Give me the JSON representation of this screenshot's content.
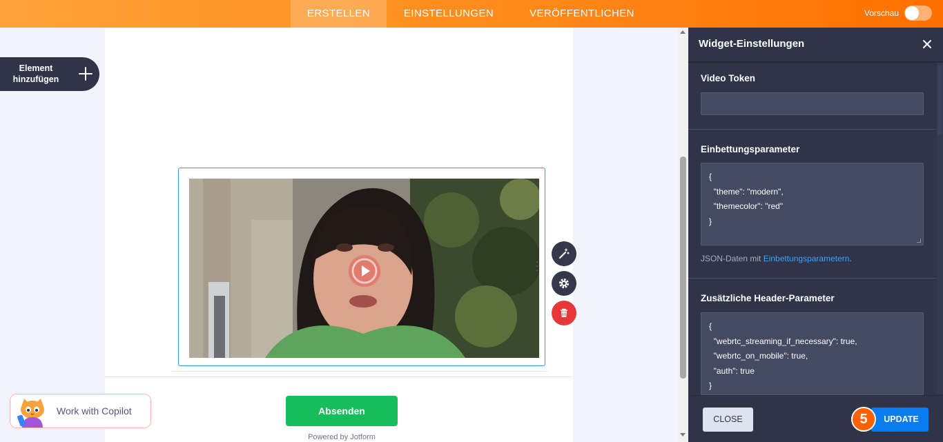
{
  "topbar": {
    "tabs": [
      {
        "label": "ERSTELLEN",
        "active": true
      },
      {
        "label": "EINSTELLUNGEN",
        "active": false
      },
      {
        "label": "VERÖFFENTLICHEN",
        "active": false
      }
    ],
    "preview_label": "Vorschau",
    "preview_on": false,
    "accent_color": "#ff8a1a"
  },
  "sidebar": {
    "add_element_label": "Element hinzufügen",
    "add_icon": "plus-icon"
  },
  "form": {
    "video": {
      "play_icon": "play-icon"
    },
    "tools": [
      "magic-wand-icon",
      "gear-icon",
      "trash-icon"
    ],
    "submit_label": "Absenden",
    "submit_color": "#18bd5b",
    "powered_by": "Powered by Jotform"
  },
  "copilot": {
    "label": "Work with Copilot"
  },
  "panel": {
    "title": "Widget-Einstellungen",
    "video_token": {
      "label": "Video Token",
      "value": ""
    },
    "embed_params": {
      "label": "Einbettungsparameter",
      "value": "{\n  \"theme\": \"modern\",\n  \"themecolor\": \"red\"\n}",
      "help_prefix": "JSON-Daten mit ",
      "help_link": "Einbettungsparametern",
      "help_suffix": "."
    },
    "header_params": {
      "label": "Zusätzliche Header-Parameter",
      "value": "{\n  \"webrtc_streaming_if_necessary\": true,\n  \"webrtc_on_mobile\": true,\n  \"auth\": true\n}"
    },
    "close_label": "CLOSE",
    "update_label": "UPDATE",
    "step_number": "5"
  }
}
